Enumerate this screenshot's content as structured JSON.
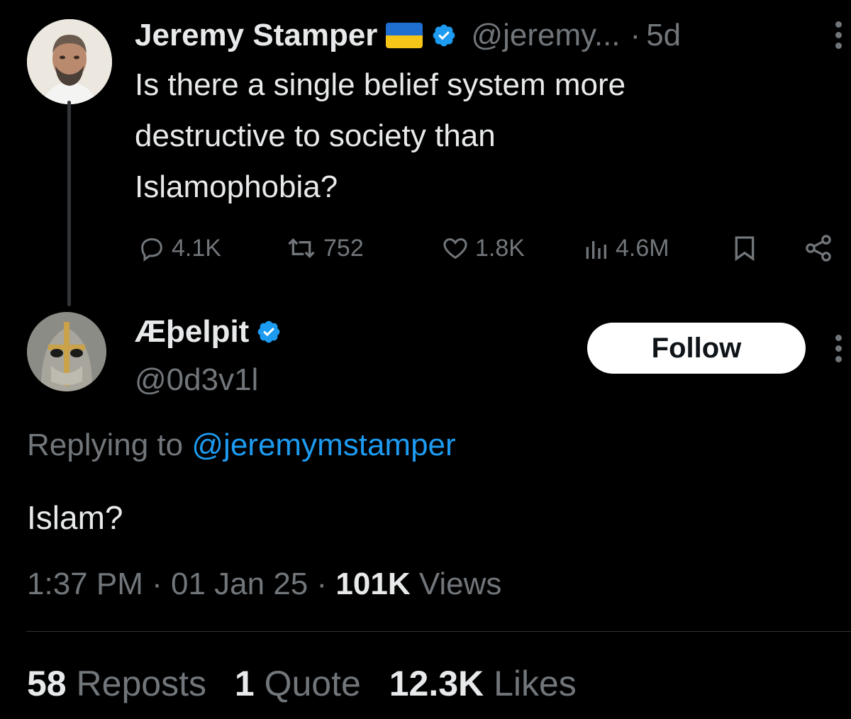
{
  "parent_tweet": {
    "author_name": "Jeremy Stamper",
    "handle": "@jeremy...",
    "separator": "·",
    "time_ago": "5d",
    "text_lines": [
      "Is there a single belief system more",
      "destructive to society than",
      "Islamophobia?"
    ],
    "actions": {
      "replies": "4.1K",
      "reposts": "752",
      "likes": "1.8K",
      "views": "4.6M"
    }
  },
  "reply_tweet": {
    "author_name": "Æþelpit",
    "handle": "@0d3v1l",
    "follow_label": "Follow",
    "replying_prefix": "Replying to",
    "replying_handle": "@jeremymstamper",
    "text": "Islam?",
    "meta": {
      "time": "1:37 PM",
      "date": "01 Jan 25",
      "views_count": "101K",
      "views_label": "Views",
      "separator": "·"
    },
    "stats": {
      "reposts_count": "58",
      "reposts_label": "Reposts",
      "quotes_count": "1",
      "quotes_label": "Quote",
      "likes_count": "12.3K",
      "likes_label": "Likes"
    }
  },
  "colors": {
    "background": "#000000",
    "text_primary": "#e7e9ea",
    "text_secondary": "#71767b",
    "accent_blue": "#1d9bf0",
    "verified_blue": "#1d9bf0",
    "follow_bg": "#ffffff"
  },
  "icons": {
    "reply": "speech-bubble-icon",
    "repost": "repost-arrows-icon",
    "like": "heart-icon",
    "views": "bar-chart-icon",
    "bookmark": "bookmark-icon",
    "share": "share-nodes-icon",
    "verified": "verified-badge-icon",
    "flag": "ukraine-flag-icon",
    "more": "vertical-dots-icon"
  }
}
